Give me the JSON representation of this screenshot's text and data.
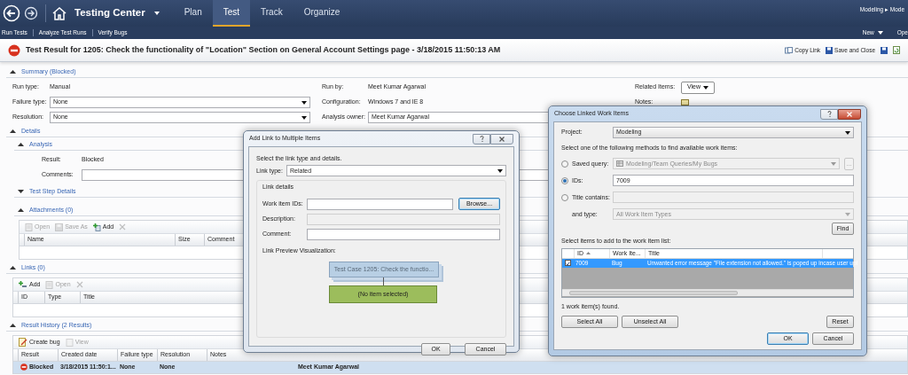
{
  "nav": {
    "app_title": "Testing Center",
    "breadcrumb": "Modeling ▸ Mode",
    "tabs": [
      {
        "label": "Plan",
        "selected": false
      },
      {
        "label": "Test",
        "selected": true
      },
      {
        "label": "Track",
        "selected": false
      },
      {
        "label": "Organize",
        "selected": false
      }
    ]
  },
  "subnav": {
    "links": [
      "Run Tests",
      "Analyze Test Runs",
      "Verify Bugs"
    ],
    "new_menu": "New",
    "cut_item": "Ope"
  },
  "header": {
    "title": "Test Result for 1205: Check the functionality of \"Location\" Section on General Account Settings page - 3/18/2015 11:50:13 AM",
    "copy_link": "Copy Link",
    "save_close": "Save and Close"
  },
  "summary": {
    "title": "Summary (Blocked)",
    "expanded": true,
    "columns": [
      {
        "fields": [
          {
            "label": "Run type:",
            "kind": "text",
            "value": "Manual"
          },
          {
            "label": "Failure type:",
            "kind": "select",
            "value": "None"
          },
          {
            "label": "Resolution:",
            "kind": "select",
            "value": "None"
          }
        ]
      },
      {
        "fields": [
          {
            "label": "Run by:",
            "kind": "text",
            "value": "Meet Kumar Agarwal"
          },
          {
            "label": "Configuration:",
            "kind": "text",
            "value": "Windows 7 and IE 8"
          },
          {
            "label": "Analysis owner:",
            "kind": "input",
            "value": "Meet Kumar Agarwal"
          }
        ]
      },
      {
        "fields": [
          {
            "label": "Related Items:",
            "kind": "button",
            "value": "View"
          },
          {
            "label": "Notes:",
            "kind": "note"
          }
        ]
      }
    ]
  },
  "details": {
    "title": "Details",
    "expanded": true,
    "analysis": {
      "title": "Analysis",
      "expanded": true,
      "fields": [
        {
          "label": "Result:",
          "kind": "text",
          "value": "Blocked"
        },
        {
          "label": "Comments:",
          "kind": "input"
        }
      ]
    },
    "test_step_details": {
      "title": "Test Step Details",
      "expanded": false
    },
    "attachments": {
      "title": "Attachments (0)",
      "expanded": true,
      "toolbar": [
        {
          "kind": "open",
          "label": "Open",
          "disabled": true
        },
        {
          "kind": "save_as",
          "label": "Save As",
          "disabled": true
        },
        {
          "kind": "add",
          "label": "Add",
          "disabled": false
        },
        {
          "kind": "delete",
          "disabled": true
        }
      ],
      "columns": [
        "Name",
        "Size",
        "Comment"
      ]
    }
  },
  "links": {
    "title": "Links (0)",
    "expanded": true,
    "toolbar": [
      {
        "kind": "add_link",
        "label": "Add",
        "disabled": false
      },
      {
        "kind": "open",
        "label": "Open",
        "disabled": true
      },
      {
        "kind": "delete",
        "disabled": true
      }
    ],
    "columns": [
      "ID",
      "Type",
      "Title"
    ]
  },
  "result_history": {
    "title": "Result History (2 Results)",
    "expanded": true,
    "toolbar": [
      {
        "kind": "create_bug",
        "label": "Create bug",
        "disabled": false
      },
      {
        "kind": "view",
        "label": "View",
        "disabled": true
      }
    ],
    "columns": [
      "Result",
      "Created date",
      "Failure type",
      "Resolution",
      "Notes"
    ],
    "rows": [
      {
        "selected": true,
        "result": "Blocked",
        "created_date": "3/18/2015 11:50:1...",
        "failure_type": "None",
        "resolution": "None",
        "column_6": "Meet Kumar Agarwal"
      }
    ]
  },
  "add_link_dialog": {
    "title": "Add Link to Multiple Items",
    "intro": "Select the link type and details.",
    "link_type": {
      "label": "Link type:",
      "value": "Related"
    },
    "details_group": {
      "title": "Link details",
      "fields": [
        {
          "label": "Work item IDs:",
          "kind": "input",
          "button": "Browse..."
        },
        {
          "label": "Description:",
          "kind": "readonly"
        },
        {
          "label": "Comment:",
          "kind": "input"
        }
      ]
    },
    "preview_label": "Link Preview Visualization:",
    "preview": {
      "source": "Test Case 1205: Check the functio...",
      "target": "(No item selected)"
    },
    "buttons": [
      "OK",
      "Cancel"
    ]
  },
  "choose_dialog": {
    "title": "Choose Linked Work Items",
    "project": {
      "label": "Project:",
      "value": "Modeling"
    },
    "instruction": "Select one of the following methods to find available work items:",
    "methods": [
      {
        "label": "Saved query:",
        "selected": false,
        "kind": "query",
        "value": "Modeling/Team Queries/My Bugs",
        "disabled": true,
        "button": "..."
      },
      {
        "label": "IDs:",
        "selected": true,
        "kind": "input",
        "value": "7009",
        "disabled": false
      },
      {
        "label": "Title contains:",
        "selected": false,
        "kind": "input",
        "disabled": true
      }
    ],
    "type_filter": {
      "label": "and type:",
      "value": "All Work Item Types",
      "disabled": true
    },
    "find_button": "Find",
    "list_label": "Select items to add to the work item list:",
    "columns": [
      "ID",
      "Work Ite...",
      "Title"
    ],
    "rows": [
      {
        "checked": true,
        "selected": true,
        "id": "7009",
        "type": "Bug",
        "title": "Unwanted error message \"File extension not allowed.\" is poped up incase user upl"
      }
    ],
    "found": "1 work item(s) found.",
    "left_buttons": [
      "Select All",
      "Unselect All"
    ],
    "reset_button": "Reset",
    "buttons": [
      "OK",
      "Cancel"
    ]
  }
}
